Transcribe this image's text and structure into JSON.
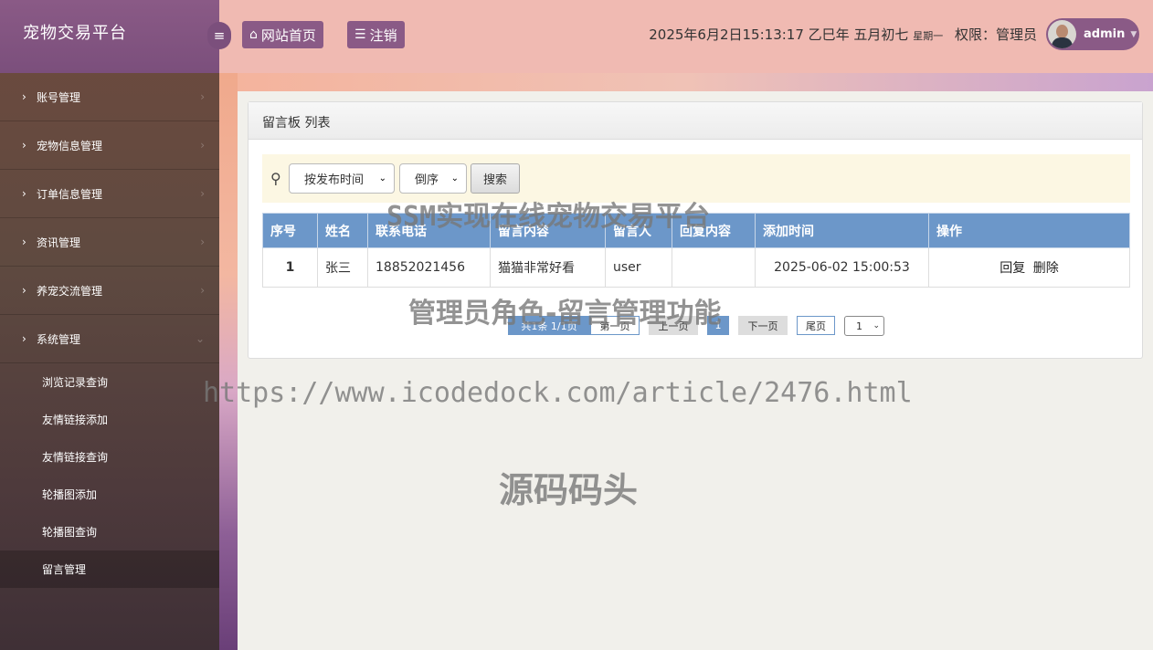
{
  "app": {
    "title": "宠物交易平台"
  },
  "header": {
    "home_label": "网站首页",
    "logout_label": "注销",
    "datetime": "2025年6月2日15:13:17 乙巳年 五月初七",
    "weekday": "星期一",
    "permission": "权限：管理员",
    "username": "admin"
  },
  "sidebar": {
    "menus": [
      {
        "label": "账号管理"
      },
      {
        "label": "宠物信息管理"
      },
      {
        "label": "订单信息管理"
      },
      {
        "label": "资讯管理"
      },
      {
        "label": "养宠交流管理"
      },
      {
        "label": "系统管理"
      }
    ],
    "submenu": [
      {
        "label": "浏览记录查询"
      },
      {
        "label": "友情链接添加"
      },
      {
        "label": "友情链接查询"
      },
      {
        "label": "轮播图添加"
      },
      {
        "label": "轮播图查询"
      },
      {
        "label": "留言管理"
      }
    ]
  },
  "panel": {
    "title": "留言板 列表",
    "sort_field": "按发布时间",
    "sort_order": "倒序",
    "search_label": "搜索"
  },
  "table": {
    "headers": [
      "序号",
      "姓名",
      "联系电话",
      "留言内容",
      "留言人",
      "回复内容",
      "添加时间",
      "操作"
    ],
    "rows": [
      {
        "index": "1",
        "name": "张三",
        "phone": "18852021456",
        "content": "猫猫非常好看",
        "author": "user",
        "reply": "",
        "time": "2025-06-02 15:00:53",
        "op_reply": "回复",
        "op_delete": "删除"
      }
    ]
  },
  "pager": {
    "info": "共1条  1/1页",
    "first": "第一页",
    "prev": "上一页",
    "current": "1",
    "next": "下一页",
    "last": "尾页",
    "page_select": "1"
  },
  "watermarks": {
    "line1": "SSM实现在线宠物交易平台",
    "line2": "管理员角色-留言管理功能",
    "line3": "https://www.icodedock.com/article/2476.html",
    "line4": "源码码头"
  }
}
